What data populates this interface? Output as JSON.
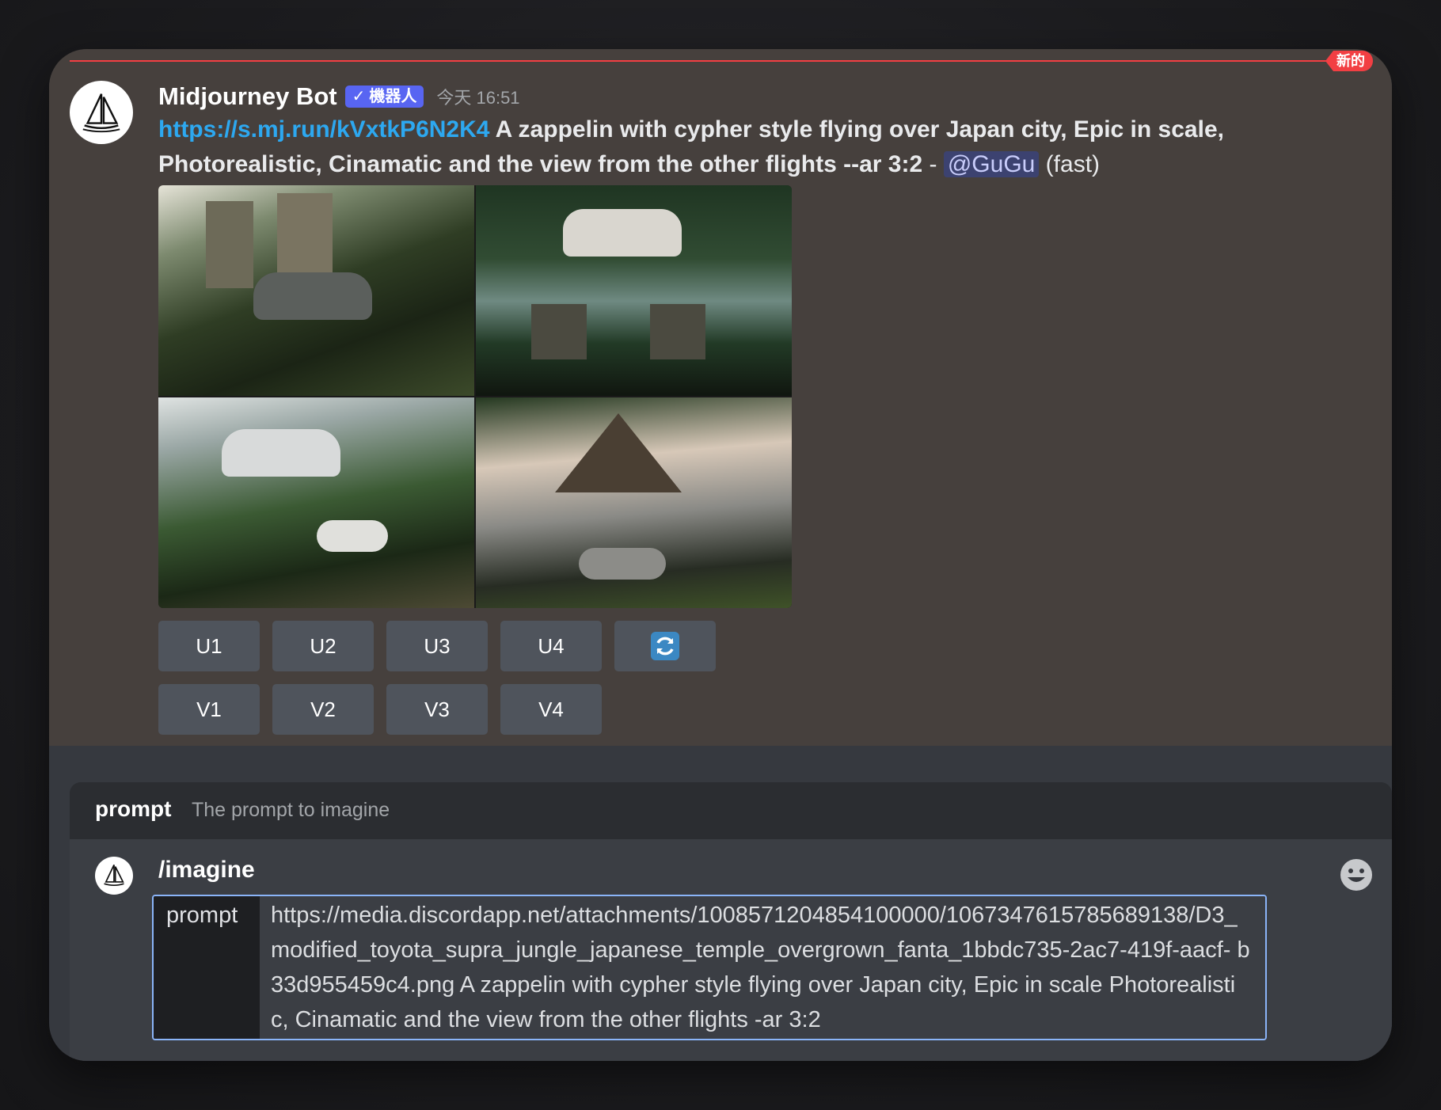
{
  "message": {
    "badge": "新的",
    "author": "Midjourney Bot",
    "bot_tag": "機器人",
    "timestamp": "今天 16:51",
    "link": "https://s.mj.run/kVxtkP6N2K4",
    "prompt_text": " A zappelin with cypher style flying over Japan city, Epic in scale, Photorealistic, Cinamatic and the view from the other flights --ar 3:2",
    "separator": " - ",
    "mention": "@GuGu",
    "speed": " (fast)",
    "avatar_icon": "sailboat-icon"
  },
  "buttons": {
    "upscale": [
      "U1",
      "U2",
      "U3",
      "U4"
    ],
    "reroll_icon": "refresh-icon",
    "variation": [
      "V1",
      "V2",
      "V3",
      "V4"
    ]
  },
  "composer": {
    "option_label": "prompt",
    "option_desc": "The prompt to imagine",
    "command": "/imagine",
    "field_name": "prompt",
    "field_value": "https://media.discordapp.net/attachments/1008571204854100000/1067347615785689138/D3_ modified_toyota_supra_jungle_japanese_temple_overgrown_fanta_1bbdc735-2ac7-419f-aacf- b33d955459c4.png A zappelin with cypher style flying over Japan city, Epic in scale Photorealistic, Cinamatic and the view from the other flights -ar 3:2",
    "emoji_icon": "smile-emoji-icon"
  },
  "colors": {
    "accent": "#5865f2",
    "link": "#2da8f0",
    "new_marker": "#f23f43",
    "focus": "#8ab4f8"
  }
}
